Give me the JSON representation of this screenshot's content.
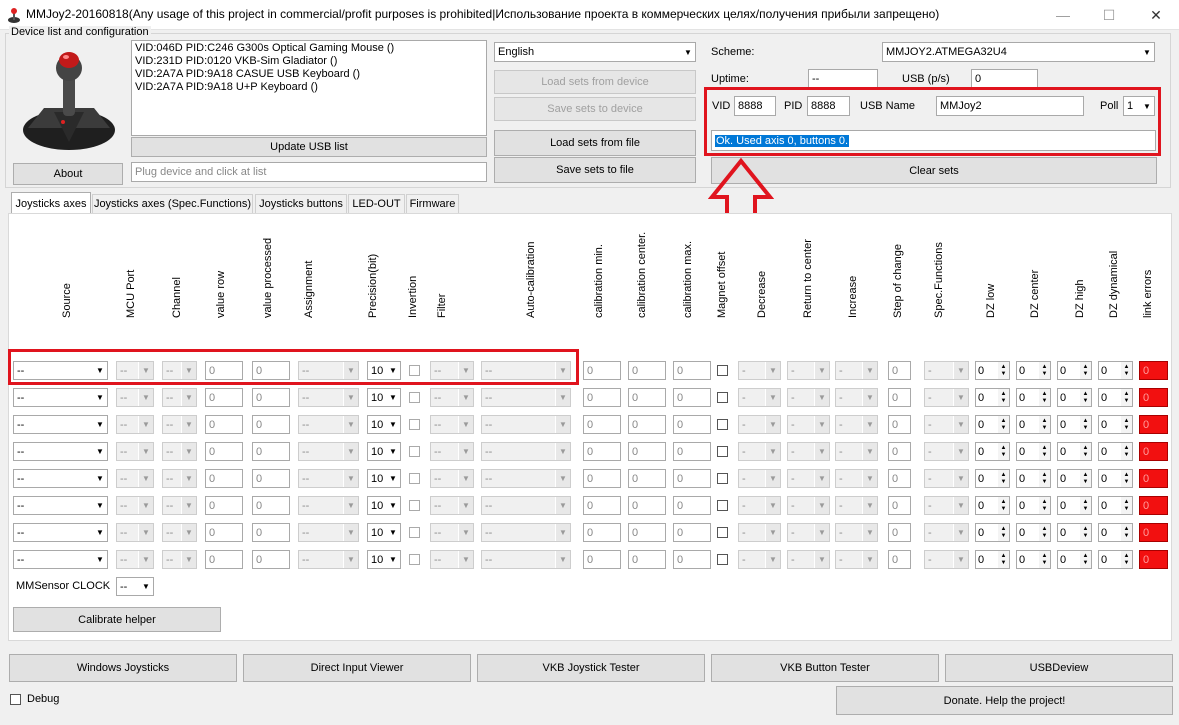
{
  "window": {
    "title": "MMJoy2-20160818(Any usage of this project in commercial/profit purposes is prohibited|Использование проекта в коммерческих целях/получения прибыли запрещено)",
    "minimize": "—",
    "maximize": "☐",
    "close": "✕"
  },
  "device_group": {
    "label": "Device list and configuration",
    "devices": [
      "VID:046D PID:C246 G300s Optical Gaming Mouse ()",
      "VID:231D PID:0120  VKB-Sim Gladiator  ()",
      "VID:2A7A PID:9A18 CASUE USB Keyboard ()",
      "VID:2A7A PID:9A18 U+P Keyboard ()"
    ],
    "update_usb_list": "Update USB list",
    "about": "About",
    "plug_placeholder": "Plug device and click at list"
  },
  "language": {
    "selected": "English"
  },
  "buttons": {
    "load_from_device": "Load sets from device",
    "save_to_device": "Save sets to device",
    "load_from_file": "Load sets from file",
    "save_to_file": "Save sets to file",
    "clear_sets": "Clear sets"
  },
  "config": {
    "scheme_label": "Scheme:",
    "scheme_value": "MMJOY2.ATMEGA32U4",
    "uptime_label": "Uptime:",
    "uptime_value": "--",
    "usb_ps_label": "USB (p/s)",
    "usb_ps_value": "0",
    "vid_label": "VID",
    "vid_value": "8888",
    "pid_label": "PID",
    "pid_value": "8888",
    "usb_name_label": "USB Name",
    "usb_name_value": "MMJoy2",
    "poll_label": "Poll",
    "poll_value": "1",
    "status": "Ok. Used axis  0, buttons 0."
  },
  "tabs": [
    "Joysticks axes",
    "Joysticks axes (Spec.Functions)",
    "Joysticks buttons",
    "LED-OUT",
    "Firmware"
  ],
  "columns": {
    "source": "Source",
    "mcu_port": "MCU Port",
    "channel": "Channel",
    "value_row": "value row",
    "value_processed": "value processed",
    "assignment": "Assignment",
    "precision": "Precision(bit)",
    "invertion": "Invertion",
    "filter": "Filter",
    "auto_calibration": "Auto-calibration",
    "cal_min": "calibration min.",
    "cal_center": "calibration center.",
    "cal_max": "calibration max.",
    "magnet_offset": "Magnet offset",
    "decrease": "Decrease",
    "return_to_center": "Return to center",
    "increase": "Increase",
    "step_of_change": "Step of change",
    "spec_functions": "Spec.Functions",
    "dz_low": "DZ low",
    "dz_center": "DZ center",
    "dz_high": "DZ high",
    "dz_dynamical": "DZ dynamical",
    "link_errors": "link errors"
  },
  "row_values": {
    "dash": "--",
    "dash_short": "-",
    "zero": "0",
    "precision": "10",
    "arrow": "▼",
    "spin_up": "▲",
    "spin_down": "▼"
  },
  "axis_row_count": 8,
  "mmsensor": {
    "label": "MMSensor CLOCK",
    "value": "--"
  },
  "calibrate_helper": "Calibrate helper",
  "bottom_buttons": [
    "Windows Joysticks",
    "Direct Input Viewer",
    "VKB Joystick Tester",
    "VKB Button Tester",
    "USBDeview"
  ],
  "debug_label": "Debug",
  "donate": "Donate. Help the project!",
  "colors": {
    "highlight": "#e0141e",
    "error": "#f21010",
    "selection": "#0078d7"
  }
}
